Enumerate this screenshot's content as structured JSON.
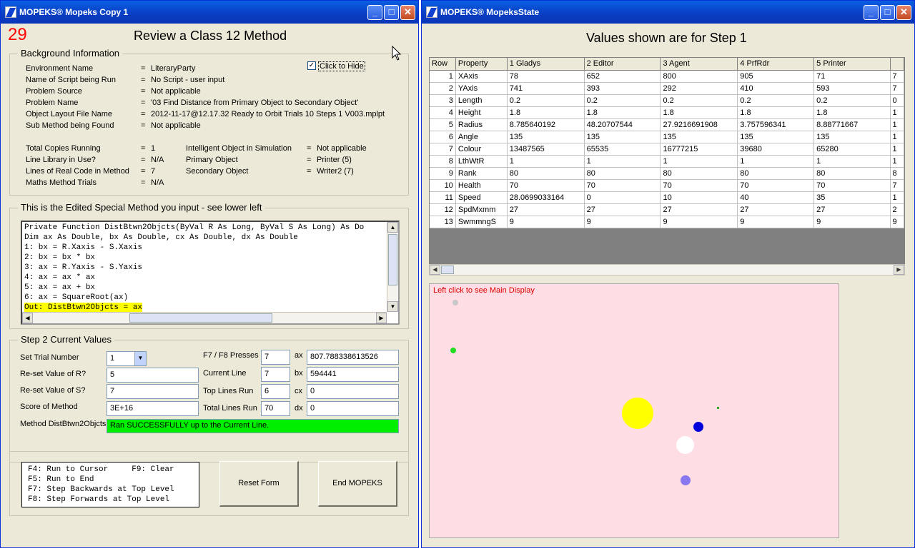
{
  "left_window": {
    "title": "MOPEKS® Mopeks Copy 1",
    "counter": "29",
    "heading": "Review a Class 12 Method",
    "background": {
      "legend": "Background Information",
      "rows": [
        {
          "label": "Environment Name",
          "eq": "=",
          "value": "LiteraryParty"
        },
        {
          "label": "Name of Script being Run",
          "eq": "=",
          "value": "No Script - user input"
        },
        {
          "label": "Problem Source",
          "eq": "=",
          "value": "Not applicable"
        },
        {
          "label": "Problem Name",
          "eq": "=",
          "value": "'03  Find Distance from Primary Object to Secondary Object'"
        },
        {
          "label": "Object Layout File Name",
          "eq": "=",
          "value": "2012-11-17@12.17.32 Ready to Orbit Trials 10 Steps 1 V003.mplpt"
        },
        {
          "label": "Sub Method being Found",
          "eq": "=",
          "value": "Not applicable"
        }
      ],
      "stats_left": [
        {
          "label": "Total Copies Running",
          "eq": "=",
          "value": "1"
        },
        {
          "label": "Line Library in Use?",
          "eq": "=",
          "value": "N/A"
        },
        {
          "label": "Lines of Real Code in Method",
          "eq": "=",
          "value": "7"
        },
        {
          "label": "Maths Method Trials",
          "eq": "=",
          "value": "N/A"
        }
      ],
      "stats_right": [
        {
          "label": "Intelligent Object in Simulation",
          "eq": "=",
          "value": "Not applicable"
        },
        {
          "label": "Primary Object",
          "eq": "=",
          "value": "Printer (5)"
        },
        {
          "label": "Secondary Object",
          "eq": "=",
          "value": "Writer2 (7)"
        }
      ],
      "hide_checkbox": {
        "label": "Click to Hide",
        "checked": true,
        "mark": "✓"
      }
    },
    "code": {
      "legend": "This is the Edited Special Method you input - see lower left",
      "lines": [
        "Private Function DistBtwn2Objcts(ByVal R As Long, ByVal S As Long) As Do",
        "Dim ax As Double, bx As Double, cx As Double, dx As Double",
        "1: bx = R.Xaxis - S.Xaxis",
        "2: bx = bx * bx",
        "3: ax = R.Yaxis - S.Yaxis",
        "4: ax = ax * ax",
        "5: ax = ax + bx",
        "6: ax = SquareRoot(ax)",
        "Out: DistBtwn2Objcts = ax"
      ]
    },
    "step": {
      "legend": "Step 2   Current Values",
      "set_trial_label": "Set Trial Number",
      "set_trial_value": "1",
      "reset_r_label": "Re-set Value of R?",
      "reset_r_value": "5",
      "reset_s_label": "Re-set Value of S?",
      "reset_s_value": "7",
      "score_label": "Score of Method",
      "score_value": "3E+16",
      "f7f8_label": "F7 / F8 Presses",
      "f7f8_value": "7",
      "current_line_label": "Current Line",
      "current_line_value": "7",
      "top_lines_label": "Top Lines Run",
      "top_lines_value": "6",
      "total_lines_label": "Total Lines Run",
      "total_lines_value": "70",
      "ax_label": "ax",
      "ax_value": "807.788338613526",
      "bx_label": "bx",
      "bx_value": "594441",
      "cx_label": "cx",
      "cx_value": "0",
      "dx_label": "dx",
      "dx_value": "0",
      "method_label": "Method DistBtwn2Objcts",
      "status_text": "Ran SUCCESSFULLY up to the Current Line.",
      "status_color": "#00ee00"
    },
    "keys": [
      "F4: Run to Cursor     F9: Clear",
      "F5: Run to End",
      "F7: Step Backwards at Top Level",
      "F8: Step Forwards at Top Level"
    ],
    "reset_button": "Reset Form",
    "end_button": "End MOPEKS"
  },
  "right_window": {
    "title": "MOPEKS® MopeksState",
    "heading": "Values shown are for Step 1",
    "table": {
      "headers": [
        "Row",
        "Property",
        "1 Gladys",
        "2 Editor",
        "3 Agent",
        "4 PrfRdr",
        "5 Printer",
        ""
      ],
      "rows": [
        [
          "1",
          "XAxis",
          "78",
          "652",
          "800",
          "905",
          "71",
          "7"
        ],
        [
          "2",
          "YAxis",
          "741",
          "393",
          "292",
          "410",
          "593",
          "7"
        ],
        [
          "3",
          "Length",
          "0.2",
          "0.2",
          "0.2",
          "0.2",
          "0.2",
          "0"
        ],
        [
          "4",
          "Height",
          "1.8",
          "1.8",
          "1.8",
          "1.8",
          "1.8",
          "1"
        ],
        [
          "5",
          "Radius",
          "8.785640192",
          "48.20707544",
          "27.9216691908",
          "3.757596341",
          "8.88771667",
          "1"
        ],
        [
          "6",
          "Angle",
          "135",
          "135",
          "135",
          "135",
          "135",
          "1"
        ],
        [
          "7",
          "Colour",
          "13487565",
          "65535",
          "16777215",
          "39680",
          "65280",
          "1"
        ],
        [
          "8",
          "LthWtR",
          "1",
          "1",
          "1",
          "1",
          "1",
          "1"
        ],
        [
          "9",
          "Rank",
          "80",
          "80",
          "80",
          "80",
          "80",
          "8"
        ],
        [
          "10",
          "Health",
          "70",
          "70",
          "70",
          "70",
          "70",
          "7"
        ],
        [
          "11",
          "Speed",
          "28.0699033164",
          "0",
          "10",
          "40",
          "35",
          "1"
        ],
        [
          "12",
          "SpdMxmm",
          "27",
          "27",
          "27",
          "27",
          "27",
          "2"
        ],
        [
          "13",
          "SwmmngS",
          "9",
          "9",
          "9",
          "9",
          "9",
          "9"
        ]
      ]
    },
    "display": {
      "hint": "Left click to see Main Display",
      "background": "#ffdde4",
      "objects": [
        {
          "color": "#c8c8c8"
        },
        {
          "color": "#22dd22"
        },
        {
          "color": "#ffff00"
        },
        {
          "color": "#0000dd"
        },
        {
          "color": "#ffffff"
        },
        {
          "color": "#8877ee"
        },
        {
          "color": "#009900"
        }
      ]
    }
  }
}
